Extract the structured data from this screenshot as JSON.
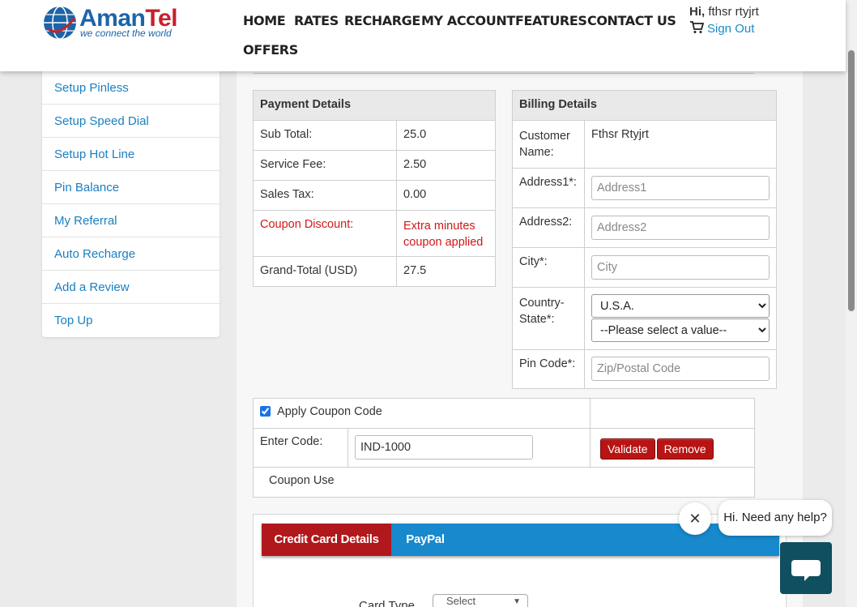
{
  "brand": {
    "name_part1": "Aman",
    "name_part2": "Tel",
    "tagline": "we connect the world"
  },
  "nav": [
    "HOME",
    "RATES",
    "RECHARGE",
    "MY ACCOUNT",
    "FEATURES",
    "CONTACT US",
    "OFFERS"
  ],
  "user": {
    "greeting": "Hi,",
    "name": "fthsr rtyjrt",
    "signout": "Sign Out"
  },
  "sidebar": {
    "items": [
      "Setup Pinless",
      "Setup Speed Dial",
      "Setup Hot Line",
      "Pin Balance",
      "My Referral",
      "Auto Recharge",
      "Add a Review",
      "Top Up"
    ]
  },
  "payment": {
    "header": "Payment Details",
    "rows": [
      {
        "label": "Sub Total:",
        "value": "25.0"
      },
      {
        "label": "Service Fee:",
        "value": "2.50"
      },
      {
        "label": "Sales Tax:",
        "value": "0.00"
      },
      {
        "label": "Coupon Discount:",
        "value": "Extra minutes coupon applied"
      },
      {
        "label": "Grand-Total (USD)",
        "value": "27.5"
      }
    ]
  },
  "billing": {
    "header": "Billing Details",
    "customer_label": "Customer Name:",
    "customer_name": "Fthsr Rtyjrt",
    "address1_label": "Address1*:",
    "address1_placeholder": "Address1",
    "address2_label": "Address2:",
    "address2_placeholder": "Address2",
    "city_label": "City*:",
    "city_placeholder": "City",
    "country_label": "Country-State*:",
    "country_value": "U.S.A.",
    "state_value": "--Please select a value--",
    "pin_label": "Pin Code*:",
    "pin_placeholder": "Zip/Postal Code"
  },
  "coupon": {
    "apply_label": "Apply Coupon Code",
    "enter_label": "Enter Code:",
    "code_value": "IND-1000",
    "validate": "Validate",
    "remove": "Remove",
    "use_label": "Coupon Use"
  },
  "payment_tabs": {
    "credit": "Credit Card Details",
    "paypal": "PayPal",
    "card_type_label": "Card Type",
    "card_type_value": "Select"
  },
  "chat": {
    "message": "Hi. Need any help?"
  },
  "colors": {
    "brand_blue": "#1c64a8",
    "brand_red": "#c8202b",
    "link_blue": "#1a7fc0",
    "button_red": "#b81414",
    "tab_blue": "#1789cc",
    "chat_dark": "#0f4f5f"
  }
}
